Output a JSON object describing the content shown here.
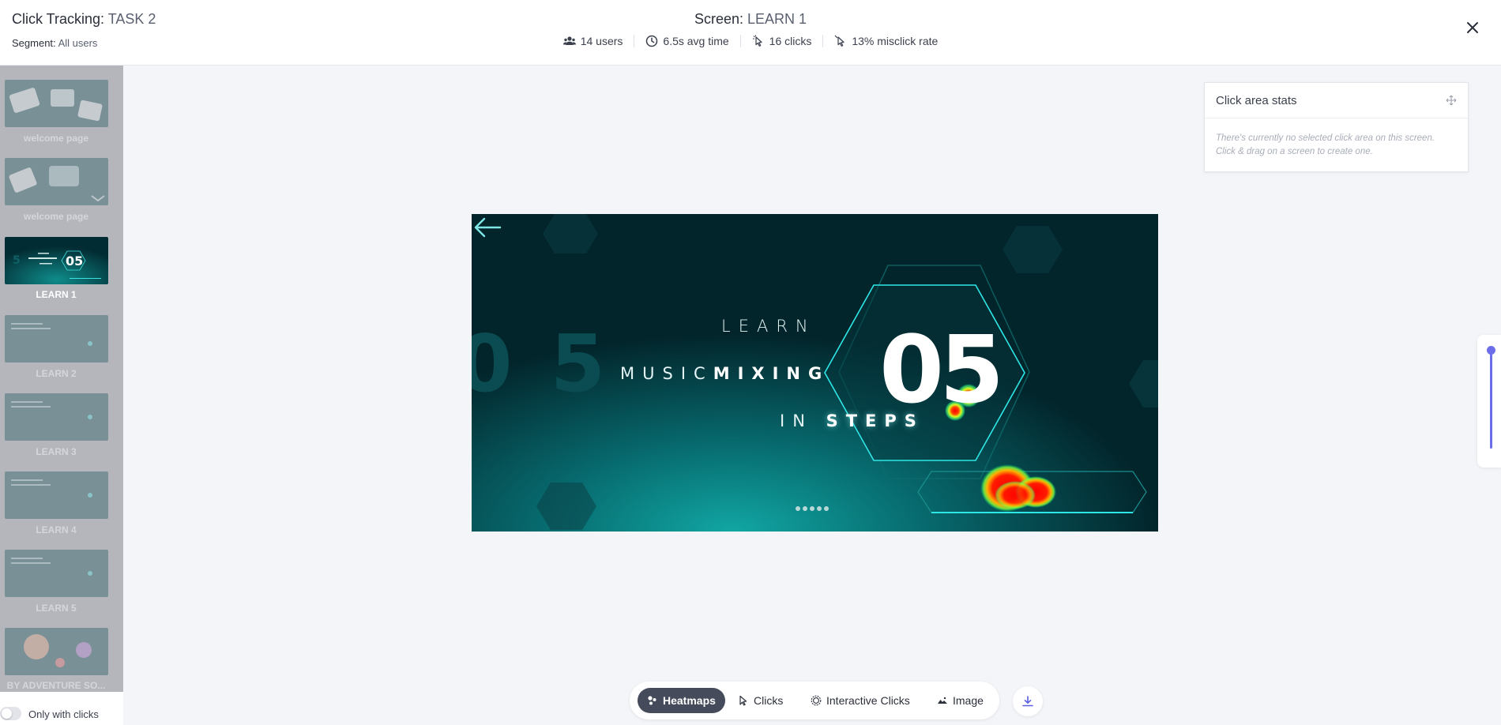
{
  "header": {
    "title_label": "Click Tracking:",
    "title_value": "TASK 2",
    "segment_label": "Segment:",
    "segment_value": "All users",
    "screen_label": "Screen:",
    "screen_value": "LEARN 1",
    "stats": [
      {
        "icon": "users-icon",
        "value": "14 users"
      },
      {
        "icon": "clock-icon",
        "value": "6.5s avg time"
      },
      {
        "icon": "cursor-icon",
        "value": "16 clicks"
      },
      {
        "icon": "misclick-icon",
        "value": "13% misclick rate"
      }
    ],
    "close_icon": "close-icon"
  },
  "sidebar": {
    "screens": [
      {
        "label": "welcome page",
        "active": false
      },
      {
        "label": "welcome page",
        "active": false
      },
      {
        "label": "LEARN 1",
        "active": true,
        "thumb_number": "05"
      },
      {
        "label": "LEARN 2",
        "active": false
      },
      {
        "label": "LEARN 3",
        "active": false
      },
      {
        "label": "LEARN 4",
        "active": false
      },
      {
        "label": "LEARN 5",
        "active": false
      },
      {
        "label": "BY ADVENTURE SO...",
        "active": false
      }
    ],
    "toggle_label": "Only with clicks",
    "toggle_on": false
  },
  "screen": {
    "line1": "LEARN",
    "line2_plain": "MUSIC",
    "line2_bold": "MIXING",
    "line3_plain": "IN",
    "line3_bold": "STEPS",
    "number": "05",
    "bg_number": "05",
    "colors": {
      "background": "#02252b",
      "accent": "#2ee6e6",
      "hex_stroke": "#1fb3b3"
    }
  },
  "click_area_stats": {
    "title": "Click area stats",
    "message": "There's currently no selected click area on this screen. Click & drag on a screen to create one."
  },
  "toolbar": {
    "items": [
      {
        "label": "Heatmaps",
        "icon": "heatmap-icon",
        "active": true
      },
      {
        "label": "Clicks",
        "icon": "cursor-icon",
        "active": false
      },
      {
        "label": "Interactive Clicks",
        "icon": "target-icon",
        "active": false
      },
      {
        "label": "Image",
        "icon": "image-icon",
        "active": false
      }
    ],
    "download_icon": "download-icon"
  }
}
